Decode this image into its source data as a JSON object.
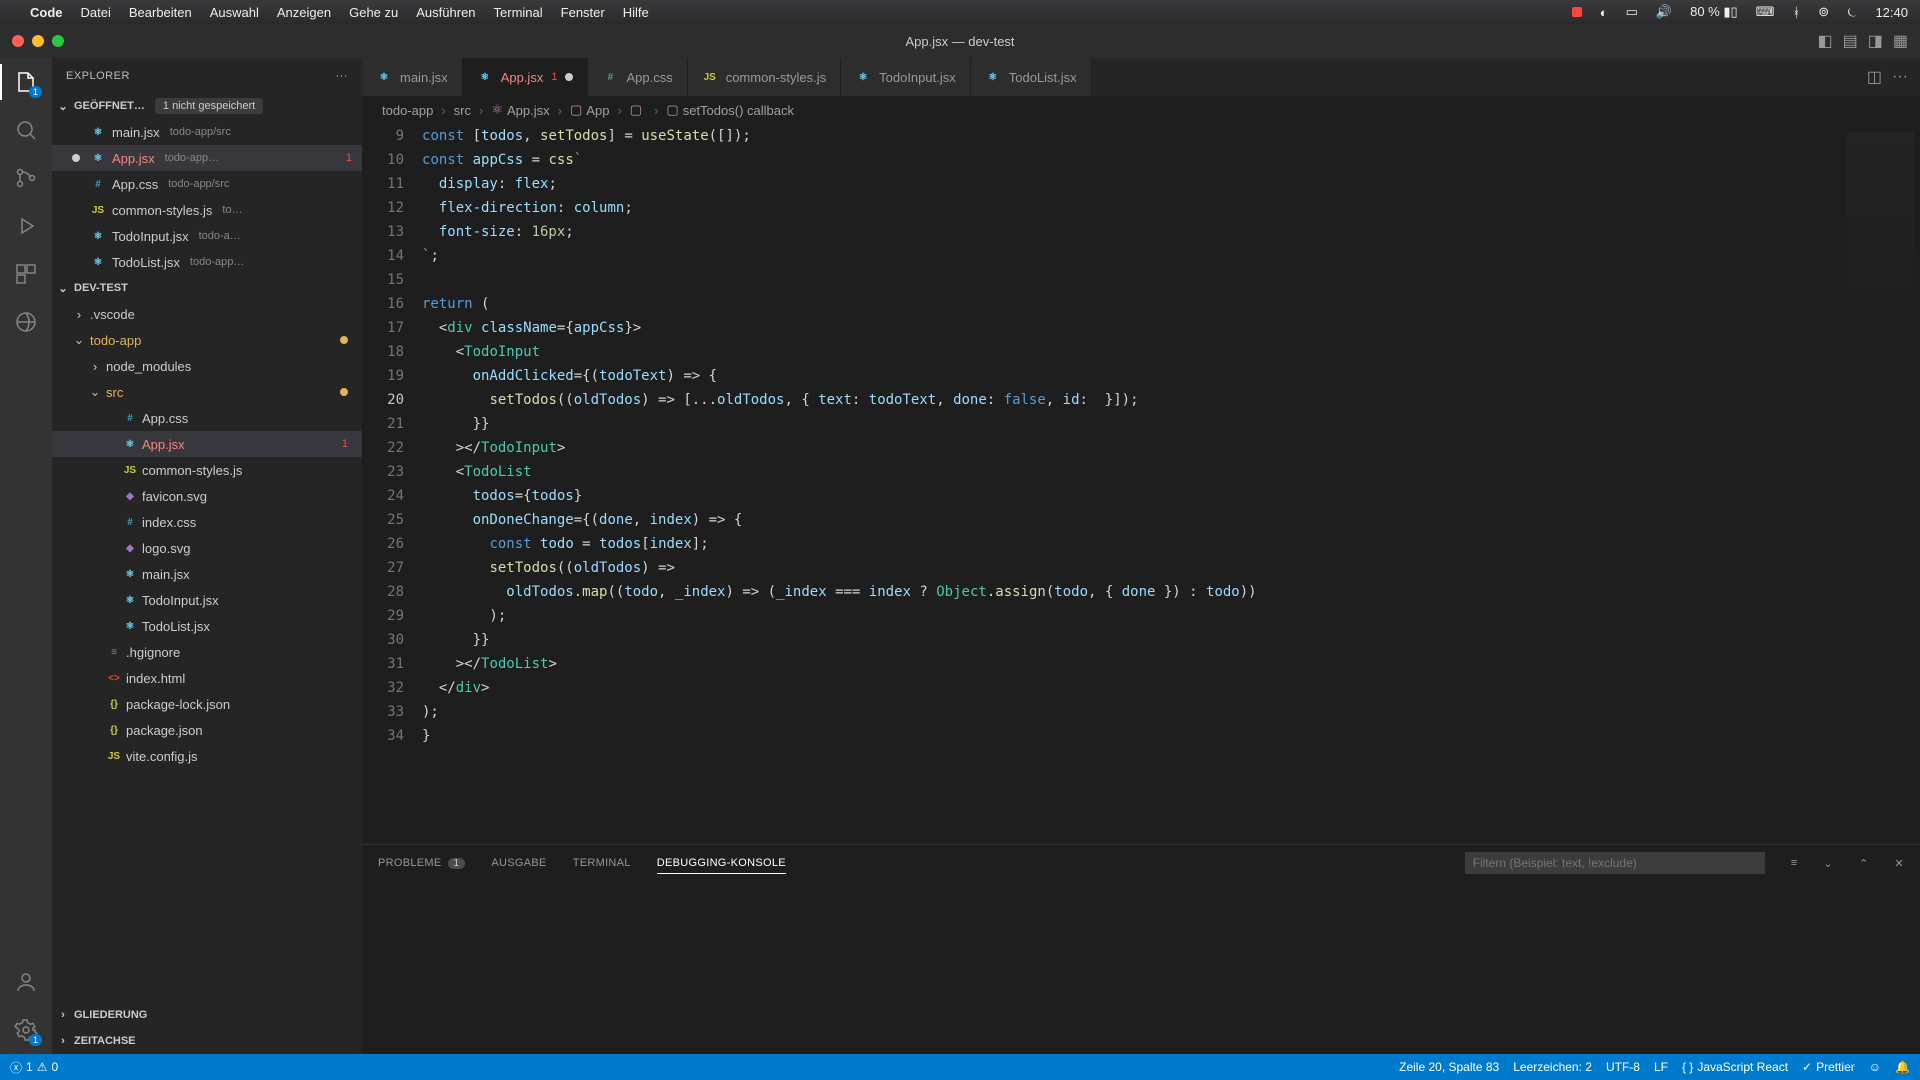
{
  "macMenu": {
    "app": "Code",
    "items": [
      "Datei",
      "Bearbeiten",
      "Auswahl",
      "Anzeigen",
      "Gehe zu",
      "Ausführen",
      "Terminal",
      "Fenster",
      "Hilfe"
    ],
    "battery": "80 %",
    "clock": "12:40"
  },
  "window": {
    "title": "App.jsx — dev-test"
  },
  "activity": {
    "explorerBadge": "1",
    "settingsBadge": "1"
  },
  "sidebar": {
    "title": "EXPLORER",
    "openEditors": {
      "label": "GEÖFFNET…",
      "unsaved": "1 nicht gespeichert",
      "items": [
        {
          "icon": "react",
          "name": "main.jsx",
          "meta": "todo-app/src"
        },
        {
          "icon": "react",
          "name": "App.jsx",
          "meta": "todo-app…",
          "modified": true,
          "error": true,
          "badge": "1"
        },
        {
          "icon": "css",
          "name": "App.css",
          "meta": "todo-app/src"
        },
        {
          "icon": "js",
          "name": "common-styles.js",
          "meta": "to…"
        },
        {
          "icon": "react",
          "name": "TodoInput.jsx",
          "meta": "todo-a…"
        },
        {
          "icon": "react",
          "name": "TodoList.jsx",
          "meta": "todo-app…"
        }
      ]
    },
    "project": {
      "label": "DEV-TEST",
      "tree": [
        {
          "depth": 1,
          "type": "folder",
          "name": ".vscode",
          "chev": ">"
        },
        {
          "depth": 1,
          "type": "folder",
          "name": "todo-app",
          "chev": "v",
          "accent": true,
          "gitdot": "#e2b35a"
        },
        {
          "depth": 2,
          "type": "folder",
          "name": "node_modules",
          "chev": ">"
        },
        {
          "depth": 2,
          "type": "folder",
          "name": "src",
          "chev": "v",
          "accent": true,
          "gitdot": "#e2b35a"
        },
        {
          "depth": 3,
          "type": "file",
          "icon": "css",
          "name": "App.css"
        },
        {
          "depth": 3,
          "type": "file",
          "icon": "react",
          "name": "App.jsx",
          "sel": true,
          "error": true,
          "errnum": "1"
        },
        {
          "depth": 3,
          "type": "file",
          "icon": "js",
          "name": "common-styles.js"
        },
        {
          "depth": 3,
          "type": "file",
          "icon": "svg",
          "name": "favicon.svg"
        },
        {
          "depth": 3,
          "type": "file",
          "icon": "css",
          "name": "index.css"
        },
        {
          "depth": 3,
          "type": "file",
          "icon": "svg",
          "name": "logo.svg"
        },
        {
          "depth": 3,
          "type": "file",
          "icon": "react",
          "name": "main.jsx"
        },
        {
          "depth": 3,
          "type": "file",
          "icon": "react",
          "name": "TodoInput.jsx"
        },
        {
          "depth": 3,
          "type": "file",
          "icon": "react",
          "name": "TodoList.jsx"
        },
        {
          "depth": 2,
          "type": "file",
          "icon": "file",
          "name": ".hgignore"
        },
        {
          "depth": 2,
          "type": "file",
          "icon": "html",
          "name": "index.html"
        },
        {
          "depth": 2,
          "type": "file",
          "icon": "json",
          "name": "package-lock.json"
        },
        {
          "depth": 2,
          "type": "file",
          "icon": "json",
          "name": "package.json"
        },
        {
          "depth": 2,
          "type": "file",
          "icon": "js",
          "name": "vite.config.js"
        }
      ]
    },
    "outline": "GLIEDERUNG",
    "timeline": "ZEITACHSE"
  },
  "tabs": [
    {
      "icon": "react",
      "label": "main.jsx"
    },
    {
      "icon": "react",
      "label": "App.jsx",
      "active": true,
      "error": true,
      "badge": "1",
      "modified": true
    },
    {
      "icon": "css",
      "label": "App.css"
    },
    {
      "icon": "js",
      "label": "common-styles.js"
    },
    {
      "icon": "react",
      "label": "TodoInput.jsx"
    },
    {
      "icon": "react",
      "label": "TodoList.jsx"
    }
  ],
  "breadcrumbs": [
    "todo-app",
    "src",
    "App.jsx",
    "App",
    "<function>",
    "setTodos() callback"
  ],
  "code": {
    "startLine": 9,
    "highlightLine": 20,
    "lines": [
      "const [todos, setTodos] = useState([]);",
      "const appCss = css`",
      "  display: flex;",
      "  flex-direction: column;",
      "  font-size: 16px;",
      "`;",
      "",
      "return (",
      "  <div className={appCss}>",
      "    <TodoInput",
      "      onAddClicked={(todoText) => {",
      "        setTodos((oldTodos) => [...oldTodos, { text: todoText, done: false, id:  }]);",
      "      }}",
      "    ></TodoInput>",
      "    <TodoList",
      "      todos={todos}",
      "      onDoneChange={(done, index) => {",
      "        const todo = todos[index];",
      "        setTodos((oldTodos) =>",
      "          oldTodos.map((todo, _index) => (_index === index ? Object.assign(todo, { done }) : todo))",
      "        );",
      "      }}",
      "    ></TodoList>",
      "  </div>",
      ");",
      "}"
    ]
  },
  "panel": {
    "tabs": {
      "problems": "PROBLEME",
      "problemsBadge": "1",
      "output": "AUSGABE",
      "terminal": "TERMINAL",
      "debug": "DEBUGGING-KONSOLE"
    },
    "filterPlaceholder": "Filtern (Beispiel: text, !exclude)"
  },
  "status": {
    "errors": "0",
    "warnings": "0",
    "errcircle": "1",
    "cursor": "Zeile 20, Spalte 83",
    "spaces": "Leerzeichen: 2",
    "encoding": "UTF-8",
    "eol": "LF",
    "lang": "JavaScript React",
    "prettier": "Prettier"
  }
}
